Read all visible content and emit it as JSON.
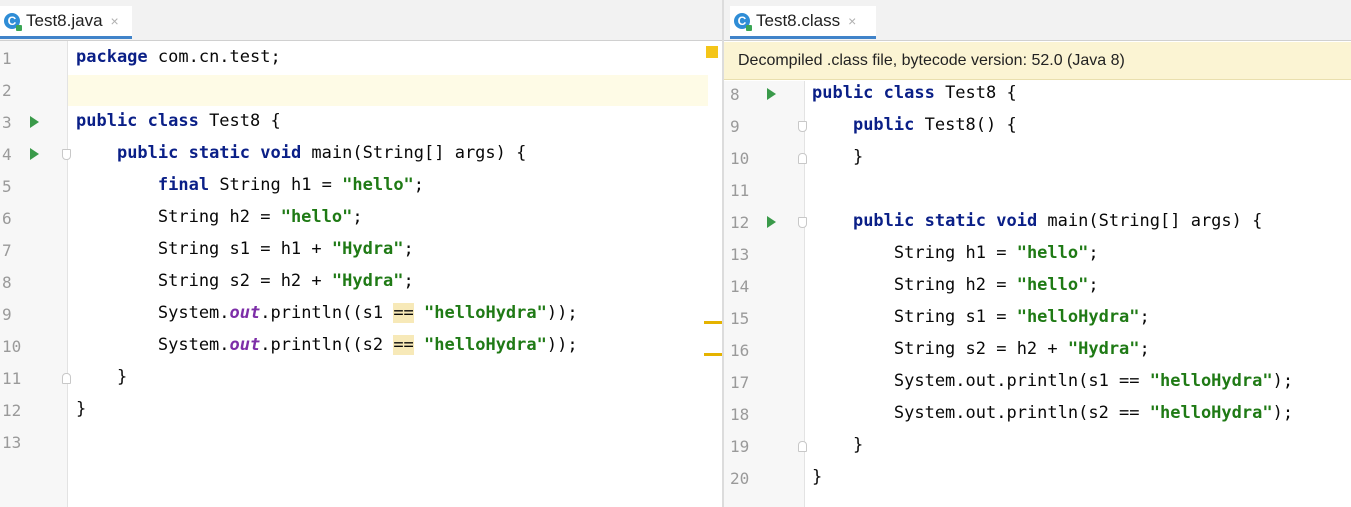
{
  "left": {
    "tab": {
      "label": "Test8.java",
      "icon": "java-class-icon",
      "close": "×"
    },
    "line_numbers": [
      "1",
      "2",
      "3",
      "4",
      "5",
      "6",
      "7",
      "8",
      "9",
      "10",
      "11",
      "12",
      "13"
    ],
    "code_lines": [
      {
        "n": "1",
        "parts": [
          [
            "kw",
            "package"
          ],
          [
            "t",
            " com.cn.test;"
          ]
        ]
      },
      {
        "n": "2",
        "parts": []
      },
      {
        "n": "3",
        "parts": [
          [
            "kw",
            "public class"
          ],
          [
            "t",
            " Test8 {"
          ]
        ]
      },
      {
        "n": "4",
        "parts": [
          [
            "t",
            "    "
          ],
          [
            "kw",
            "public static void"
          ],
          [
            "t",
            " main(String[] args) {"
          ]
        ]
      },
      {
        "n": "5",
        "parts": [
          [
            "t",
            "        "
          ],
          [
            "kw",
            "final"
          ],
          [
            "t",
            " String h1 = "
          ],
          [
            "str",
            "\"hello\""
          ],
          [
            "t",
            ";"
          ]
        ]
      },
      {
        "n": "6",
        "parts": [
          [
            "t",
            "        String h2 = "
          ],
          [
            "str",
            "\"hello\""
          ],
          [
            "t",
            ";"
          ]
        ]
      },
      {
        "n": "7",
        "parts": [
          [
            "t",
            "        String s1 = h1 + "
          ],
          [
            "str",
            "\"Hydra\""
          ],
          [
            "t",
            ";"
          ]
        ]
      },
      {
        "n": "8",
        "parts": [
          [
            "t",
            "        String s2 = h2 + "
          ],
          [
            "str",
            "\"Hydra\""
          ],
          [
            "t",
            ";"
          ]
        ]
      },
      {
        "n": "9",
        "parts": [
          [
            "t",
            "        System."
          ],
          [
            "fld",
            "out"
          ],
          [
            "t",
            ".println((s1 "
          ],
          [
            "op",
            "=="
          ],
          [
            "t",
            " "
          ],
          [
            "str",
            "\"helloHydra\""
          ],
          [
            "t",
            "));"
          ]
        ]
      },
      {
        "n": "10",
        "parts": [
          [
            "t",
            "        System."
          ],
          [
            "fld",
            "out"
          ],
          [
            "t",
            ".println((s2 "
          ],
          [
            "op",
            "=="
          ],
          [
            "t",
            " "
          ],
          [
            "str",
            "\"helloHydra\""
          ],
          [
            "t",
            "));"
          ]
        ]
      },
      {
        "n": "11",
        "parts": [
          [
            "t",
            "    }"
          ]
        ]
      },
      {
        "n": "12",
        "parts": [
          [
            "t",
            "}"
          ]
        ]
      },
      {
        "n": "13",
        "parts": []
      }
    ]
  },
  "right": {
    "tab": {
      "label": "Test8.class",
      "icon": "java-class-icon",
      "close": "×"
    },
    "banner": "Decompiled .class file, bytecode version: 52.0 (Java 8)",
    "code_lines": [
      {
        "n": "8",
        "parts": [
          [
            "kw",
            "public class"
          ],
          [
            "t",
            " Test8 {"
          ]
        ]
      },
      {
        "n": "9",
        "parts": [
          [
            "t",
            "    "
          ],
          [
            "kw",
            "public"
          ],
          [
            "t",
            " Test8() {"
          ]
        ]
      },
      {
        "n": "10",
        "parts": [
          [
            "t",
            "    }"
          ]
        ]
      },
      {
        "n": "11",
        "parts": []
      },
      {
        "n": "12",
        "parts": [
          [
            "t",
            "    "
          ],
          [
            "kw",
            "public static void"
          ],
          [
            "t",
            " main(String[] args) {"
          ]
        ]
      },
      {
        "n": "13",
        "parts": [
          [
            "t",
            "        String h1 = "
          ],
          [
            "str",
            "\"hello\""
          ],
          [
            "t",
            ";"
          ]
        ]
      },
      {
        "n": "14",
        "parts": [
          [
            "t",
            "        String h2 = "
          ],
          [
            "str",
            "\"hello\""
          ],
          [
            "t",
            ";"
          ]
        ]
      },
      {
        "n": "15",
        "parts": [
          [
            "t",
            "        String s1 = "
          ],
          [
            "str",
            "\"helloHydra\""
          ],
          [
            "t",
            ";"
          ]
        ]
      },
      {
        "n": "16",
        "parts": [
          [
            "t",
            "        String s2 = h2 + "
          ],
          [
            "str",
            "\"Hydra\""
          ],
          [
            "t",
            ";"
          ]
        ]
      },
      {
        "n": "17",
        "parts": [
          [
            "t",
            "        System.out.println(s1 == "
          ],
          [
            "str",
            "\"helloHydra\""
          ],
          [
            "t",
            ");"
          ]
        ]
      },
      {
        "n": "18",
        "parts": [
          [
            "t",
            "        System.out.println(s2 == "
          ],
          [
            "str",
            "\"helloHydra\""
          ],
          [
            "t",
            ");"
          ]
        ]
      },
      {
        "n": "19",
        "parts": [
          [
            "t",
            "    }"
          ]
        ]
      },
      {
        "n": "20",
        "parts": [
          [
            "t",
            "}"
          ]
        ]
      }
    ]
  },
  "colors": {
    "keyword": "#0a1f87",
    "string": "#1f7a15",
    "field": "#7d2ea8",
    "run": "#3a9a4a",
    "warning": "#f4c518"
  }
}
